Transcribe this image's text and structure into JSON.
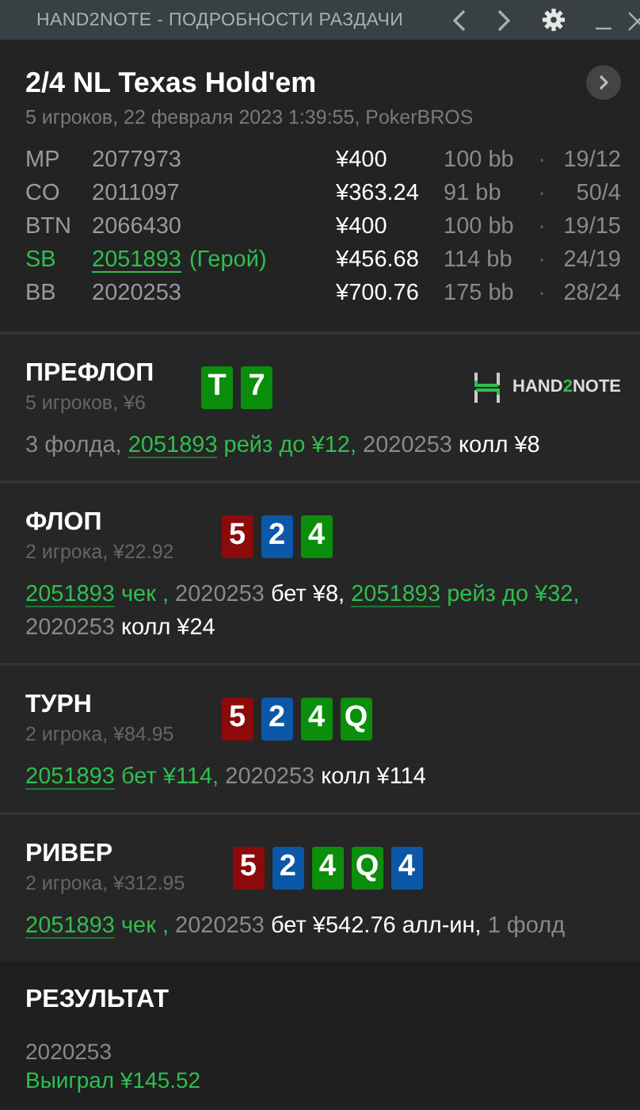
{
  "window": {
    "title": "HAND2NOTE - ПОДРОБНОСТИ РАЗДАЧИ"
  },
  "hand": {
    "title": "2/4 NL Texas Hold'em",
    "subtitle": "5 игроков, 22 февраля 2023 1:39:55, PokerBROS"
  },
  "players": [
    {
      "position": "MP",
      "name": "2077973",
      "hero": false,
      "stack": "¥400",
      "bb": "100 bb",
      "separator": "·",
      "stats": "19/12"
    },
    {
      "position": "CO",
      "name": "2011097",
      "hero": false,
      "stack": "¥363.24",
      "bb": "91 bb",
      "separator": "·",
      "stats": "50/4"
    },
    {
      "position": "BTN",
      "name": "2066430",
      "hero": false,
      "stack": "¥400",
      "bb": "100 bb",
      "separator": "·",
      "stats": "19/15"
    },
    {
      "position": "SB",
      "name": "2051893",
      "hero": true,
      "hero_label": "(Герой)",
      "stack": "¥456.68",
      "bb": "114 bb",
      "separator": "·",
      "stats": "24/19"
    },
    {
      "position": "BB",
      "name": "2020253",
      "hero": false,
      "stack": "¥700.76",
      "bb": "175 bb",
      "separator": "·",
      "stats": "28/24"
    }
  ],
  "logo": {
    "parts": [
      {
        "text": "HAND",
        "accent": false
      },
      {
        "text": "2",
        "accent": true
      },
      {
        "text": "NOTE",
        "accent": false
      }
    ]
  },
  "streets": [
    {
      "name": "ПРЕФЛОП",
      "subtitle": "5 игроков, ¥6",
      "cards": [
        {
          "rank": "T",
          "color": "#0b8e0b"
        },
        {
          "rank": "7",
          "color": "#0b8e0b"
        }
      ],
      "actions": [
        {
          "kind": "fold",
          "text": "3 фолда, "
        },
        {
          "kind": "hero",
          "text": "2051893"
        },
        {
          "kind": "hero-action",
          "text": " рейз до ¥12, "
        },
        {
          "kind": "player",
          "text": "2020253"
        },
        {
          "kind": "action",
          "text": " колл ¥8"
        }
      ]
    },
    {
      "name": "ФЛОП",
      "subtitle": "2 игрока, ¥22.92",
      "cards": [
        {
          "rank": "5",
          "color": "#8c0a0a"
        },
        {
          "rank": "2",
          "color": "#0b58a8"
        },
        {
          "rank": "4",
          "color": "#0b8e0b"
        }
      ],
      "actions": [
        {
          "kind": "hero",
          "text": "2051893"
        },
        {
          "kind": "hero-action",
          "text": " чек , "
        },
        {
          "kind": "player",
          "text": "2020253"
        },
        {
          "kind": "action",
          "text": " бет ¥8, "
        },
        {
          "kind": "hero",
          "text": "2051893"
        },
        {
          "kind": "hero-action",
          "text": " рейз до ¥32, "
        },
        {
          "kind": "player",
          "text": "2020253"
        },
        {
          "kind": "action",
          "text": " колл ¥24"
        }
      ]
    },
    {
      "name": "ТУРН",
      "subtitle": "2 игрока, ¥84.95",
      "cards": [
        {
          "rank": "5",
          "color": "#8c0a0a"
        },
        {
          "rank": "2",
          "color": "#0b58a8"
        },
        {
          "rank": "4",
          "color": "#0b8e0b"
        },
        {
          "rank": "Q",
          "color": "#0b8e0b"
        }
      ],
      "actions": [
        {
          "kind": "hero",
          "text": "2051893"
        },
        {
          "kind": "hero-action",
          "text": " бет ¥114, "
        },
        {
          "kind": "player",
          "text": "2020253"
        },
        {
          "kind": "action",
          "text": " колл ¥114"
        }
      ]
    },
    {
      "name": "РИВЕР",
      "subtitle": "2 игрока, ¥312.95",
      "cards": [
        {
          "rank": "5",
          "color": "#8c0a0a"
        },
        {
          "rank": "2",
          "color": "#0b58a8"
        },
        {
          "rank": "4",
          "color": "#0b8e0b"
        },
        {
          "rank": "Q",
          "color": "#0b8e0b"
        },
        {
          "rank": "4",
          "color": "#0b58a8"
        }
      ],
      "actions": [
        {
          "kind": "hero",
          "text": "2051893"
        },
        {
          "kind": "hero-action",
          "text": " чек , "
        },
        {
          "kind": "player",
          "text": "2020253"
        },
        {
          "kind": "action",
          "text": " бет ¥542.76 алл-ин, "
        },
        {
          "kind": "fold",
          "text": "1 фолд"
        }
      ]
    }
  ],
  "result": {
    "title": "РЕЗУЛЬТАТ",
    "winner": "2020253",
    "outcome": "Выиграл ¥145.52"
  }
}
